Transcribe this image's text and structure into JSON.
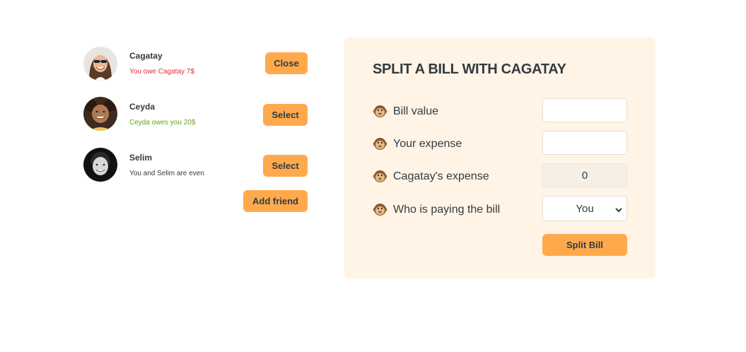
{
  "friends": [
    {
      "name": "Cagatay",
      "status": "You owe Cagatay 7$",
      "button": "Close"
    },
    {
      "name": "Ceyda",
      "status": "Ceyda owes you 20$",
      "button": "Select"
    },
    {
      "name": "Selim",
      "status": "You and Selim are even",
      "button": "Select"
    }
  ],
  "add_friend_label": "Add friend",
  "form": {
    "title": "Split a bill with Cagatay",
    "emoji": "monkey-face-icon",
    "bill_label": "Bill value",
    "bill_value": "",
    "expense_label": "Your expense",
    "expense_value": "",
    "friend_expense_label": "Cagatay's expense",
    "friend_expense_value": "0",
    "payer_label": "Who is paying the bill",
    "payer_selected": "You",
    "submit_label": "Split Bill"
  },
  "colors": {
    "accent": "#ffa94d",
    "form_bg": "#fff4e6",
    "owe": "#e03131",
    "owed": "#66a80f"
  }
}
